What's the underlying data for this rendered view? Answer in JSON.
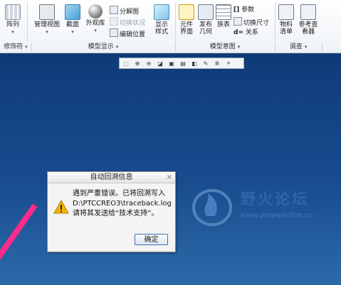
{
  "ribbon": {
    "arrange_label": "阵列",
    "manage_view_label": "管理视图",
    "section_label": "截面",
    "appearance_label": "外观库",
    "explode_label": "分解图",
    "toggle_state_label": "切换状况",
    "edit_position_label": "编辑位置",
    "display_style_label": "显示\n样式",
    "element_interface_label": "元件\n界面",
    "publish_geom_label": "发布\n几何",
    "table_label": "族表",
    "params_label": "参数",
    "switch_size_label": "切换尺寸",
    "relations_label": "关系",
    "bom_label": "物料\n清单",
    "ref_viewer_label": "参考查\n看器",
    "groups": {
      "modifier": "修饰符",
      "model_display": "模型显示",
      "model_intent": "模型意图",
      "investigate": "调查"
    }
  },
  "view_toolbar": {
    "icons": [
      "refit-icon",
      "zoom-in-icon",
      "zoom-out-icon",
      "repaint-icon",
      "display-style-icon",
      "saved-view-icon",
      "section-icon",
      "annotation-icon",
      "spin-center-icon",
      "datum-display-icon"
    ]
  },
  "dialog": {
    "title": "自动回溯信息",
    "close": "×",
    "line1": "遇到严重错误。已将回溯写入",
    "line2": "D:\\PTCCREO3\\traceback.log",
    "line3": "请将其发送给“技术支持”。",
    "ok_label": "确定"
  },
  "watermark": {
    "title": "野火论坛",
    "url": "www.proewildfire.cn"
  },
  "colors": {
    "viewport_top": "#0f3a78",
    "viewport_bottom": "#2c6aa8",
    "pink": "#ff2a8a",
    "warn": "#f4b400"
  }
}
